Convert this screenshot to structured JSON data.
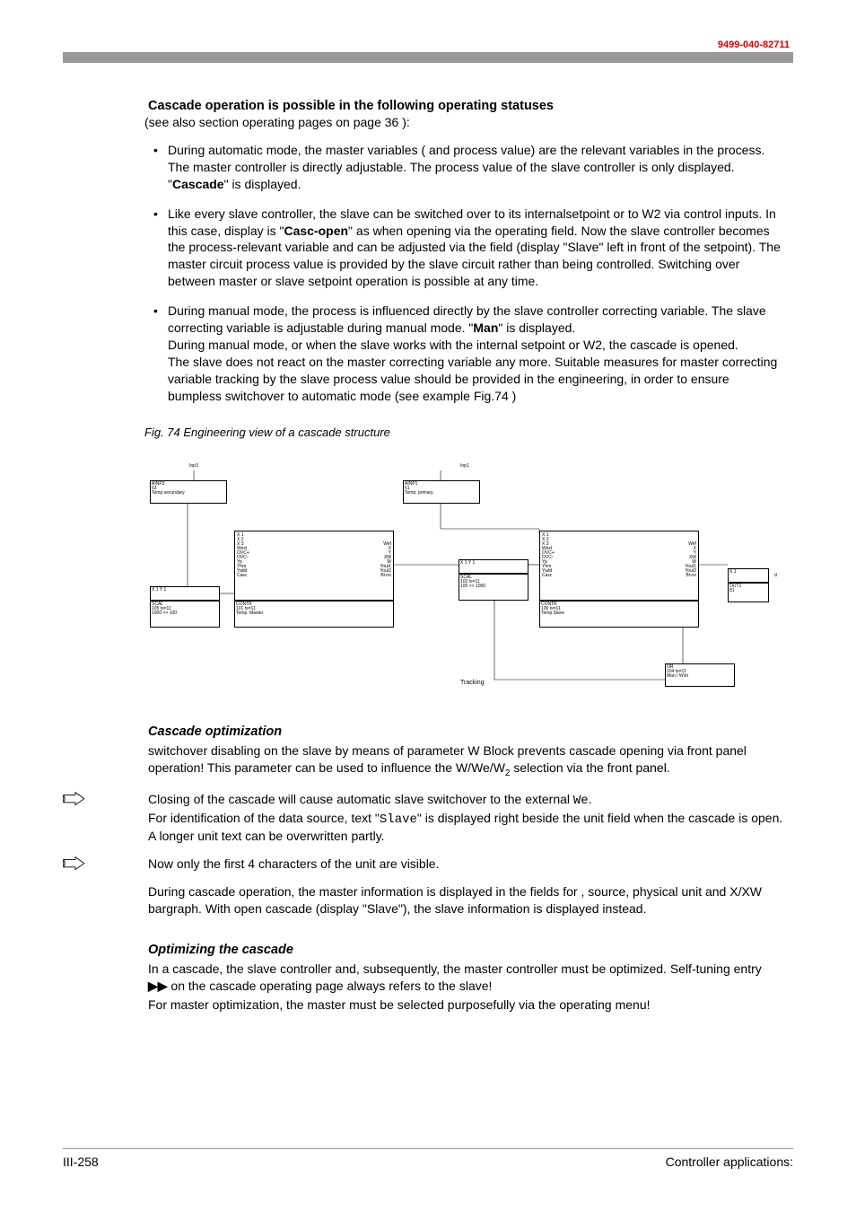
{
  "header": {
    "code": "9499-040-82711"
  },
  "section1": {
    "title": "Cascade operation is possible in the following operating statuses",
    "subnote": "(see also section operating pages on page 36 ):",
    "bullets": [
      {
        "pre": "During automatic mode, the master variables ( and process value) are the relevant variables in the process. The master controller is directly adjustable. The process value of the slave controller is only displayed. \"",
        "bold": "Cascade",
        "post": "\" is displayed."
      },
      {
        "pre": "Like every slave controller, the slave can be switched over to its internalsetpoint or to W2 via control inputs. In this case, display is  \"",
        "bold": "Casc-open",
        "post": "\" as when opening via the operating field. Now the slave controller  becomes the process-relevant variable and can be adjusted via the  field (display \"Slave\" left in front of the setpoint). The master circuit process value is provided by the slave circuit rather than being controlled.  Switching over between master or slave setpoint operation is possible at any time."
      },
      {
        "pre": "During manual mode, the process is influenced directly by the slave controller correcting variable. The slave correcting variable is adjustable during manual mode. \"",
        "bold": "Man",
        "post": "\" is displayed.",
        "extra": "During manual mode, or when the slave works with the internal setpoint or W2, the cascade is opened.\nThe slave does not react on the master correcting variable any more. Suitable measures for master correcting variable tracking by the slave process value should be provided in the engineering, in order to ensure bumpless switchover to automatic mode (see example Fig.74 )"
      }
    ]
  },
  "figure": {
    "caption": "Fig. 74   Engineering view of a cascade structure"
  },
  "diagram": {
    "ainp3": "AINP3",
    "ainp3_num": "63",
    "ainp3_label": "Temp.secundary",
    "ainp1": "AINP1",
    "ainp1_num": "61",
    "ainp1_label": "Temp. primary",
    "inp3": "Inp3",
    "inp1": "Inp1",
    "scal_left": "SCAL",
    "scal_left_l1": "105 ts=11",
    "scal_left_l2": "1000 >> 100",
    "scal_mid": "SCAL",
    "scal_mid_l1": "102 ts=11",
    "scal_mid_l2": "100 >> 1000",
    "contr_master": "CONTR",
    "contr_master_l1": "101 ts=11",
    "contr_master_l2": "Temp. Master",
    "contr_slave": "CONTR",
    "contr_slave_l1": "100 ts=11",
    "contr_slave_l2": "Temp.Slave",
    "out1": "OUT1",
    "out1_num": "81",
    "or_blk": "OR",
    "or_l1": "104 ts=11",
    "or_l2": "Man / Wint",
    "tracking": "Tracking",
    "io_left": "X 1\nX 2\nX 3\nWext\nOVC+\nOVC-\nYp\nYhm\nYadd\nCasc",
    "io_right": "Wef\nX\nY\nXW\nW\nYout1\nYout2\nBl-no",
    "x1y1": "X 1        Y 1",
    "x1": "X 1",
    "d": "d"
  },
  "section2": {
    "title": "Cascade  optimization",
    "p1_pre": " switchover disabling on the slave by means of parameter  W Block  prevents cascade opening via front panel operation! This parameter can be used to influence the W/We/W",
    "p1_sub": "2",
    "p1_post": " selection via the front panel.",
    "p2_pre": "Closing of the cascade will cause automatic slave switchover to the external   ",
    "p2_mono1": "We",
    "p2_mid": ".\nFor identification of the data source, text \"",
    "p2_mono2": "Slave",
    "p2_post": "\"  is displayed right beside the unit field when the cascade is open. A longer unit text can be overwritten partly.",
    "p3": "Now only the first 4 characters of the unit are visible.",
    "p4": "During cascade operation, the master information is displayed in the fields for ,  source, physical unit and  X/XW bargraph. With open cascade (display \"Slave\"), the slave information is displayed instead."
  },
  "section3": {
    "title": "Optimizing the cascade",
    "p1_pre": "In a cascade, the slave controller and, subsequently, the master controller must be optimized.  Self-tuning entry  ",
    "p1_arrows": "▶▶",
    "p1_post": " on the cascade operating page always refers to the slave!",
    "p2": "For master optimization, the master must be selected purposefully via the operating menu!"
  },
  "footer": {
    "left": "III-258",
    "right": "Controller applications:"
  }
}
